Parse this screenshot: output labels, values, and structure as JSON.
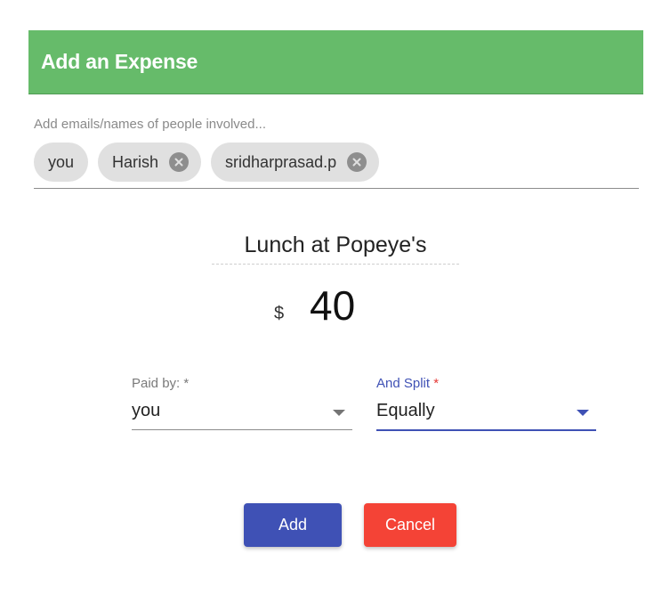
{
  "dialog": {
    "title": "Add an Expense",
    "header_color": "#66bb6a"
  },
  "people": {
    "placeholder": "Add emails/names of people involved...",
    "chips": [
      {
        "label": "you",
        "removable": false
      },
      {
        "label": "Harish",
        "removable": true,
        "icon": "cancel-circle-icon"
      },
      {
        "label": "sridharprasad.p",
        "removable": true,
        "icon": "cancel-circle-icon"
      }
    ]
  },
  "expense": {
    "description": "Lunch at Popeye's",
    "currency_symbol": "$",
    "amount": "40"
  },
  "paid_by": {
    "label": "Paid by:",
    "required_mark": "*",
    "value": "you",
    "icon": "dropdown-arrow-icon"
  },
  "split": {
    "label": "And Split",
    "required_mark": "*",
    "value": "Equally",
    "icon": "dropdown-arrow-icon",
    "accent_color": "#3f51b5"
  },
  "actions": {
    "add_label": "Add",
    "add_color": "#3f51b5",
    "cancel_label": "Cancel",
    "cancel_color": "#f44336"
  }
}
